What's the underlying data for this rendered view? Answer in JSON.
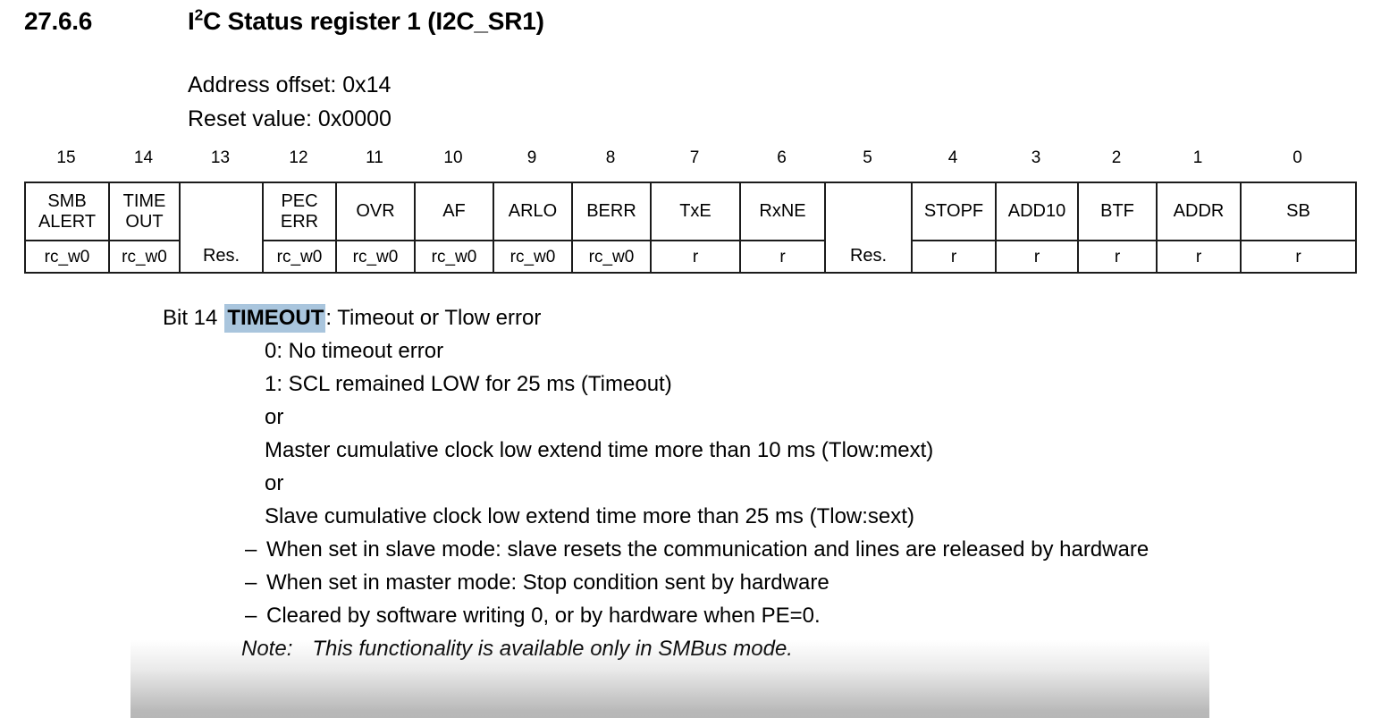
{
  "heading": {
    "section_number": "27.6.6",
    "title_prefix": "I",
    "title_sup": "2",
    "title_rest": "C Status register 1 (I2C_SR1)"
  },
  "meta": {
    "address_offset": "Address offset: 0x14",
    "reset_value": "Reset value: 0x0000"
  },
  "register_table": {
    "bit_numbers": [
      "15",
      "14",
      "13",
      "12",
      "11",
      "10",
      "9",
      "8",
      "7",
      "6",
      "5",
      "4",
      "3",
      "2",
      "1",
      "0"
    ],
    "fields": [
      {
        "name": "SMB\nALERT",
        "access": "rc_w0"
      },
      {
        "name": "TIME\nOUT",
        "access": "rc_w0"
      },
      {
        "name": "Res.",
        "access": ""
      },
      {
        "name": "PEC\nERR",
        "access": "rc_w0"
      },
      {
        "name": "OVR",
        "access": "rc_w0"
      },
      {
        "name": "AF",
        "access": "rc_w0"
      },
      {
        "name": "ARLO",
        "access": "rc_w0"
      },
      {
        "name": "BERR",
        "access": "rc_w0"
      },
      {
        "name": "TxE",
        "access": "r"
      },
      {
        "name": "RxNE",
        "access": "r"
      },
      {
        "name": "Res.",
        "access": ""
      },
      {
        "name": "STOPF",
        "access": "r"
      },
      {
        "name": "ADD10",
        "access": "r"
      },
      {
        "name": "BTF",
        "access": "r"
      },
      {
        "name": "ADDR",
        "access": "r"
      },
      {
        "name": "SB",
        "access": "r"
      }
    ]
  },
  "bit_description": {
    "bit_label": "Bit 14",
    "field_name": "TIMEOUT",
    "field_title": ": Timeout or Tlow error",
    "highlight_color": "#a9c5dd",
    "values": [
      "0: No timeout error",
      "1: SCL remained LOW for 25 ms (Timeout)",
      "or",
      "Master cumulative clock low extend time more than 10 ms (Tlow:mext)",
      "or",
      "Slave cumulative clock low extend time more than 25 ms (Tlow:sext)"
    ],
    "bullets": [
      "When set in slave mode: slave resets the communication and lines are released by hardware",
      "When set in master mode: Stop condition sent by hardware",
      "Cleared by software writing 0, or by hardware when PE=0."
    ],
    "dash": "–",
    "note_label": "Note:",
    "note_text": "This functionality is available only in SMBus mode."
  }
}
